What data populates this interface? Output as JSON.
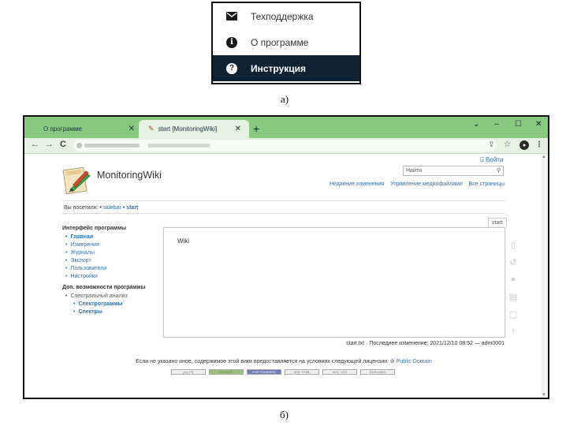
{
  "menu": {
    "items": [
      {
        "label": "Техподдержка",
        "icon": "mail-icon"
      },
      {
        "label": "О программе",
        "icon": "info-icon"
      },
      {
        "label": "Инструкция",
        "icon": "help-icon",
        "active": true
      }
    ]
  },
  "captions": {
    "a": "а)",
    "b": "б)"
  },
  "browser": {
    "tabs": [
      {
        "label": "О программе",
        "close": "✕"
      },
      {
        "label": "start [MonitoringWiki]",
        "close": "✕"
      }
    ],
    "new_tab": "+",
    "window": {
      "chevron": "⌄",
      "minimize": "–",
      "maximize": "☐",
      "close": "✕"
    },
    "nav": {
      "back": "←",
      "forward": "→",
      "reload": "C"
    }
  },
  "wiki": {
    "login": "Войти",
    "title": "MonitoringWiki",
    "search_placeholder": "Найти",
    "top_links": [
      "Недавние изменения",
      "Управление медиафайлами",
      "Все страницы"
    ],
    "trace": {
      "label": "Вы посетили:",
      "items": [
        "sidebar",
        "start"
      ]
    },
    "sidebar": {
      "section1": "Интерфейс программы",
      "items1": [
        "Главная",
        "Измерения",
        "Журналы",
        "Экспорт",
        "Пользователи",
        "Настройки"
      ],
      "section2": "Доп. возможности программы",
      "items2_parent": "Спектральный анализ",
      "items2_sub": [
        "Спектрограммы",
        "Спектры"
      ]
    },
    "page_tag": "start",
    "content": "Wiki",
    "doc_info": "start.txt · Последнее изменение: 2021/12/10 08:52 — adm0001",
    "license_text": "Если не указано иное, содержимое этой вики предоставляется на условиях следующей лицензии:",
    "license_link": "Public Domain",
    "badges": [
      "(cc) PD",
      "DONATE",
      "PHP POWERED",
      "W3C HTML",
      "W3C CSS",
      "DOKUWIKI"
    ]
  }
}
